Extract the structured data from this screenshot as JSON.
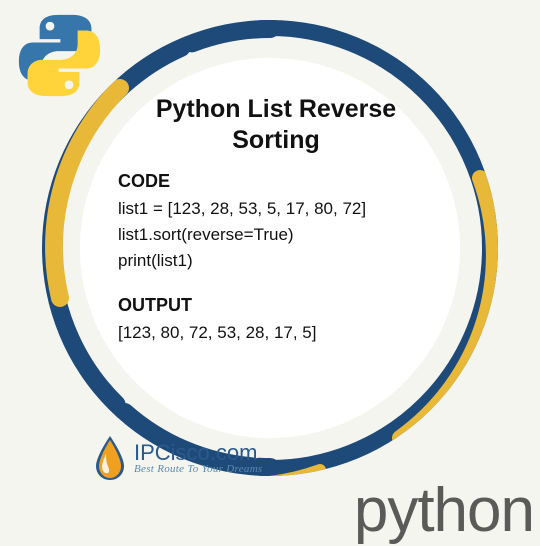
{
  "title_line1": "Python List Reverse",
  "title_line2": "Sorting",
  "section_code_label": "CODE",
  "code_lines": [
    "list1 = [123, 28, 53, 5, 17, 80, 72]",
    "list1.sort(reverse=True)",
    "print(list1)"
  ],
  "section_output_label": "OUTPUT",
  "output_line": "[123, 80, 72, 53, 28, 17, 5]",
  "branding": {
    "name": "IPCisco.com",
    "tagline": "Best Route To Your Dreams"
  },
  "footer_word": "python",
  "colors": {
    "ring_navy": "#1e4a7a",
    "ring_gold": "#e8b838",
    "logo_blue": "#3776ab",
    "logo_yellow": "#ffd43b"
  }
}
